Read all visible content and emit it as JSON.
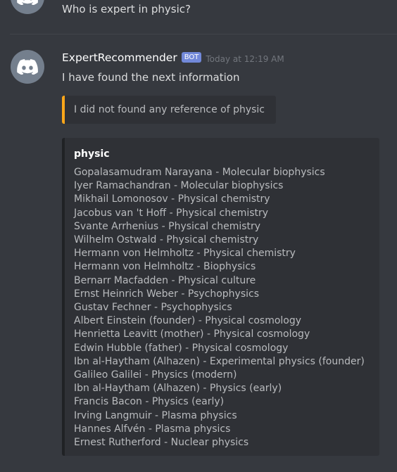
{
  "previous_message": {
    "text": "Who is expert in physic?"
  },
  "message": {
    "username": "ExpertRecommender",
    "tag": "BOT",
    "timestamp": "Today at 12:19 AM",
    "text": "I have found the next information"
  },
  "embed_warning": {
    "text": "I did not found any reference of physic",
    "accent_color": "#faa61a"
  },
  "embed_results": {
    "title": "physic",
    "accent_color": "#202225",
    "items": [
      "Gopalasamudram Narayana - Molecular biophysics",
      "Iyer Ramachandran - Molecular biophysics",
      "Mikhail Lomonosov - Physical chemistry",
      "Jacobus van 't Hoff - Physical chemistry",
      "Svante Arrhenius - Physical chemistry",
      "Wilhelm Ostwald - Physical chemistry",
      "Hermann von Helmholtz - Physical chemistry",
      "Hermann von Helmholtz - Biophysics",
      "Bernarr Macfadden - Physical culture",
      "Ernst Heinrich Weber - Psychophysics",
      "Gustav Fechner - Psychophysics",
      "Albert Einstein (founder) - Physical cosmology",
      "Henrietta Leavitt (mother) - Physical cosmology",
      "Edwin Hubble (father) - Physical cosmology",
      "Ibn al-Haytham (Alhazen) - Experimental physics (founder)",
      "Galileo Galilei - Physics (modern)",
      "Ibn al-Haytham (Alhazen) - Physics (early)",
      "Francis Bacon - Physics (early)",
      "Irving Langmuir - Plasma physics",
      "Hannes Alfvén - Plasma physics",
      "Ernest Rutherford - Nuclear physics"
    ]
  },
  "icons": {
    "avatar": "discord-logo-icon"
  },
  "colors": {
    "background": "#36393f",
    "bot_tag": "#7289da",
    "avatar_bg": "#747f8d"
  }
}
